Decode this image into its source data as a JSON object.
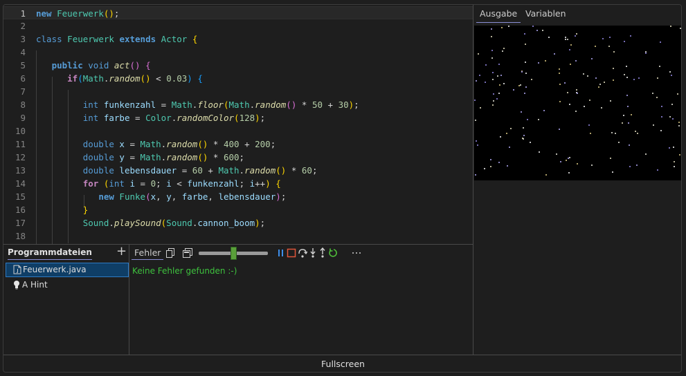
{
  "editor": {
    "current_line": 1,
    "lines": [
      {
        "n": "1"
      },
      {
        "n": "2"
      },
      {
        "n": "3"
      },
      {
        "n": "4"
      },
      {
        "n": "5"
      },
      {
        "n": "6"
      },
      {
        "n": "7"
      },
      {
        "n": "8"
      },
      {
        "n": "9"
      },
      {
        "n": "10"
      },
      {
        "n": "11"
      },
      {
        "n": "12"
      },
      {
        "n": "13"
      },
      {
        "n": "14"
      },
      {
        "n": "15"
      },
      {
        "n": "16"
      },
      {
        "n": "17"
      },
      {
        "n": "18"
      }
    ],
    "code": [
      [
        [
          "kwb",
          "new"
        ],
        [
          "txt",
          " "
        ],
        [
          "cls",
          "Feuerwerk"
        ],
        [
          "par",
          "()"
        ],
        [
          "txt",
          ";"
        ]
      ],
      [],
      [
        [
          "kw",
          "class"
        ],
        [
          "txt",
          " "
        ],
        [
          "cls",
          "Feuerwerk"
        ],
        [
          "txt",
          " "
        ],
        [
          "kwb",
          "extends"
        ],
        [
          "txt",
          " "
        ],
        [
          "cls",
          "Actor"
        ],
        [
          "txt",
          " "
        ],
        [
          "par",
          "{"
        ]
      ],
      [],
      [
        [
          "txt",
          "   "
        ],
        [
          "kwb",
          "public"
        ],
        [
          "txt",
          " "
        ],
        [
          "kw",
          "void"
        ],
        [
          "txt",
          " "
        ],
        [
          "fni",
          "act"
        ],
        [
          "par2",
          "()"
        ],
        [
          "txt",
          " "
        ],
        [
          "par2",
          "{"
        ]
      ],
      [
        [
          "txt",
          "      "
        ],
        [
          "kwp",
          "if"
        ],
        [
          "par3",
          "("
        ],
        [
          "cls",
          "Math"
        ],
        [
          "txt",
          "."
        ],
        [
          "fni",
          "random"
        ],
        [
          "par",
          "()"
        ],
        [
          "txt",
          " < "
        ],
        [
          "num",
          "0.03"
        ],
        [
          "par3",
          ")"
        ],
        [
          "txt",
          " "
        ],
        [
          "par3",
          "{"
        ]
      ],
      [],
      [
        [
          "txt",
          "         "
        ],
        [
          "kw",
          "int"
        ],
        [
          "txt",
          " "
        ],
        [
          "var",
          "funkenzahl"
        ],
        [
          "txt",
          " = "
        ],
        [
          "cls",
          "Math"
        ],
        [
          "txt",
          "."
        ],
        [
          "fni",
          "floor"
        ],
        [
          "par",
          "("
        ],
        [
          "cls",
          "Math"
        ],
        [
          "txt",
          "."
        ],
        [
          "fni",
          "random"
        ],
        [
          "par2",
          "()"
        ],
        [
          "txt",
          " * "
        ],
        [
          "num",
          "50"
        ],
        [
          "txt",
          " + "
        ],
        [
          "num",
          "30"
        ],
        [
          "par",
          ")"
        ],
        [
          "txt",
          ";"
        ]
      ],
      [
        [
          "txt",
          "         "
        ],
        [
          "kw",
          "int"
        ],
        [
          "txt",
          " "
        ],
        [
          "var",
          "farbe"
        ],
        [
          "txt",
          " = "
        ],
        [
          "cls",
          "Color"
        ],
        [
          "txt",
          "."
        ],
        [
          "fni",
          "randomColor"
        ],
        [
          "par",
          "("
        ],
        [
          "num",
          "128"
        ],
        [
          "par",
          ")"
        ],
        [
          "txt",
          ";"
        ]
      ],
      [],
      [
        [
          "txt",
          "         "
        ],
        [
          "kw",
          "double"
        ],
        [
          "txt",
          " "
        ],
        [
          "var",
          "x"
        ],
        [
          "txt",
          " = "
        ],
        [
          "cls",
          "Math"
        ],
        [
          "txt",
          "."
        ],
        [
          "fni",
          "random"
        ],
        [
          "par",
          "()"
        ],
        [
          "txt",
          " * "
        ],
        [
          "num",
          "400"
        ],
        [
          "txt",
          " + "
        ],
        [
          "num",
          "200"
        ],
        [
          "txt",
          ";"
        ]
      ],
      [
        [
          "txt",
          "         "
        ],
        [
          "kw",
          "double"
        ],
        [
          "txt",
          " "
        ],
        [
          "var",
          "y"
        ],
        [
          "txt",
          " = "
        ],
        [
          "cls",
          "Math"
        ],
        [
          "txt",
          "."
        ],
        [
          "fni",
          "random"
        ],
        [
          "par",
          "()"
        ],
        [
          "txt",
          " * "
        ],
        [
          "num",
          "600"
        ],
        [
          "txt",
          ";"
        ]
      ],
      [
        [
          "txt",
          "         "
        ],
        [
          "kw",
          "double"
        ],
        [
          "txt",
          " "
        ],
        [
          "var",
          "lebensdauer"
        ],
        [
          "txt",
          " = "
        ],
        [
          "num",
          "60"
        ],
        [
          "txt",
          " + "
        ],
        [
          "cls",
          "Math"
        ],
        [
          "txt",
          "."
        ],
        [
          "fni",
          "random"
        ],
        [
          "par",
          "()"
        ],
        [
          "txt",
          " * "
        ],
        [
          "num",
          "60"
        ],
        [
          "txt",
          ";"
        ]
      ],
      [
        [
          "txt",
          "         "
        ],
        [
          "kwp",
          "for"
        ],
        [
          "txt",
          " "
        ],
        [
          "par",
          "("
        ],
        [
          "kw",
          "int"
        ],
        [
          "txt",
          " "
        ],
        [
          "var",
          "i"
        ],
        [
          "txt",
          " = "
        ],
        [
          "num",
          "0"
        ],
        [
          "txt",
          "; "
        ],
        [
          "var",
          "i"
        ],
        [
          "txt",
          " < "
        ],
        [
          "var",
          "funkenzahl"
        ],
        [
          "txt",
          "; "
        ],
        [
          "var",
          "i"
        ],
        [
          "txt",
          "++"
        ],
        [
          "par",
          ")"
        ],
        [
          "txt",
          " "
        ],
        [
          "par",
          "{"
        ]
      ],
      [
        [
          "txt",
          "            "
        ],
        [
          "kwb",
          "new"
        ],
        [
          "txt",
          " "
        ],
        [
          "cls",
          "Funke"
        ],
        [
          "par2",
          "("
        ],
        [
          "var",
          "x"
        ],
        [
          "txt",
          ", "
        ],
        [
          "var",
          "y"
        ],
        [
          "txt",
          ", "
        ],
        [
          "var",
          "farbe"
        ],
        [
          "txt",
          ", "
        ],
        [
          "var",
          "lebensdauer"
        ],
        [
          "par2",
          ")"
        ],
        [
          "txt",
          ";"
        ]
      ],
      [
        [
          "txt",
          "         "
        ],
        [
          "par",
          "}"
        ]
      ],
      [
        [
          "txt",
          "         "
        ],
        [
          "cls",
          "Sound"
        ],
        [
          "txt",
          "."
        ],
        [
          "fni",
          "playSound"
        ],
        [
          "par",
          "("
        ],
        [
          "cls",
          "Sound"
        ],
        [
          "txt",
          "."
        ],
        [
          "var",
          "cannon_boom"
        ],
        [
          "par",
          ")"
        ],
        [
          "txt",
          ";"
        ]
      ],
      []
    ]
  },
  "right_panel": {
    "tabs": [
      "Ausgabe",
      "Variablen"
    ],
    "active_tab": "Ausgabe"
  },
  "files": {
    "title": "Programmdateien",
    "add_symbol": "+",
    "items": [
      {
        "label": "Feuerwerk.java",
        "icon": "java-file-icon",
        "selected": true
      },
      {
        "label": "A Hint",
        "icon": "lightbulb-icon",
        "selected": false
      }
    ]
  },
  "errors": {
    "tab_label": "Fehler",
    "message": "Keine Fehler gefunden :-)",
    "message_color": "#3ec23e",
    "speed_fraction": 0.5
  },
  "footer": {
    "label": "Fullscreen"
  },
  "colors": {
    "accent": "#8a8fd6",
    "selection": "#0f3e66",
    "slider_thumb": "#5aa03a"
  }
}
